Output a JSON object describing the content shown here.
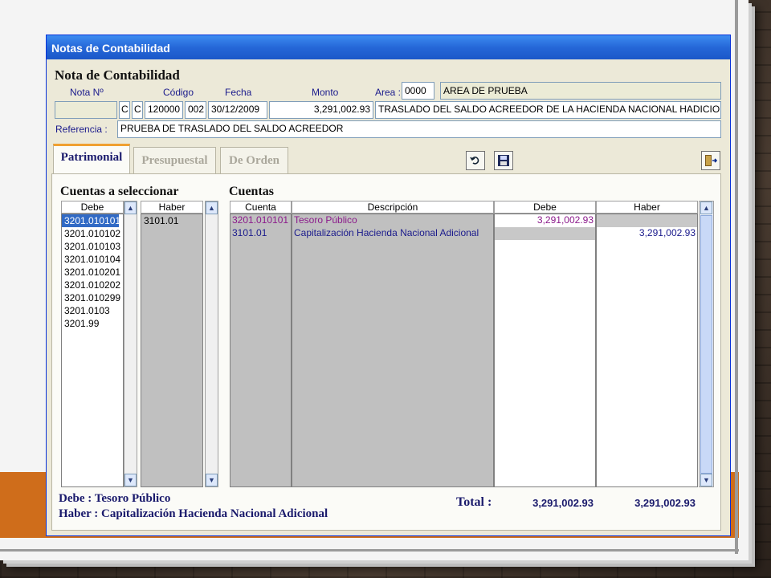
{
  "window": {
    "title": "Notas de Contabilidad"
  },
  "form": {
    "heading": "Nota de Contabilidad",
    "labels": {
      "nota": "Nota Nº",
      "codigo": "Código",
      "fecha": "Fecha",
      "monto": "Monto",
      "area": "Area :",
      "referencia": "Referencia :"
    },
    "values": {
      "nota": "",
      "c1": "C",
      "c2": "C",
      "codigo": "120000",
      "codigo2": "002",
      "fecha": "30/12/2009",
      "monto": "3,291,002.93",
      "area_code": "0000",
      "area_name": "AREA DE PRUEBA",
      "descripcion": "TRASLADO DEL SALDO ACREEDOR DE LA HACIENDA NACIONAL HADICIONA",
      "referencia": "PRUEBA DE TRASLADO DEL SALDO ACREEDOR"
    }
  },
  "tabs": [
    "Patrimonial",
    "Presupuestal",
    "De Orden"
  ],
  "toolbar": {
    "undo_icon": "undo-icon",
    "save_icon": "save-icon",
    "exit_icon": "exit-door-icon"
  },
  "left": {
    "title": "Cuentas a seleccionar",
    "debe_header": "Debe",
    "haber_header": "Haber",
    "debe_items": [
      "3201.010101",
      "3201.010102",
      "3201.010103",
      "3201.010104",
      "3201.010201",
      "3201.010202",
      "3201.010299",
      "3201.0103",
      "3201.99"
    ],
    "haber_items": [
      "3101.01"
    ]
  },
  "right": {
    "title": "Cuentas",
    "headers": [
      "Cuenta",
      "Descripción",
      "Debe",
      "Haber"
    ],
    "rows": [
      {
        "cuenta": "3201.010101",
        "descripcion": "Tesoro Público",
        "debe": "3,291,002.93",
        "haber": ""
      },
      {
        "cuenta": "3101.01",
        "descripcion": "Capitalización Hacienda Nacional Adicional",
        "debe": "",
        "haber": "3,291,002.93"
      }
    ]
  },
  "footer": {
    "debe_line": "Debe : Tesoro Público",
    "haber_line": "Haber : Capitalización Hacienda Nacional Adicional",
    "total_label": "Total :",
    "total_debe": "3,291,002.93",
    "total_haber": "3,291,002.93"
  },
  "colors": {
    "accent_magenta": "#8b1a8b",
    "selection": "#316ac5",
    "title_blue": "#2567d8",
    "slide_orange": "#cf6d1b"
  }
}
